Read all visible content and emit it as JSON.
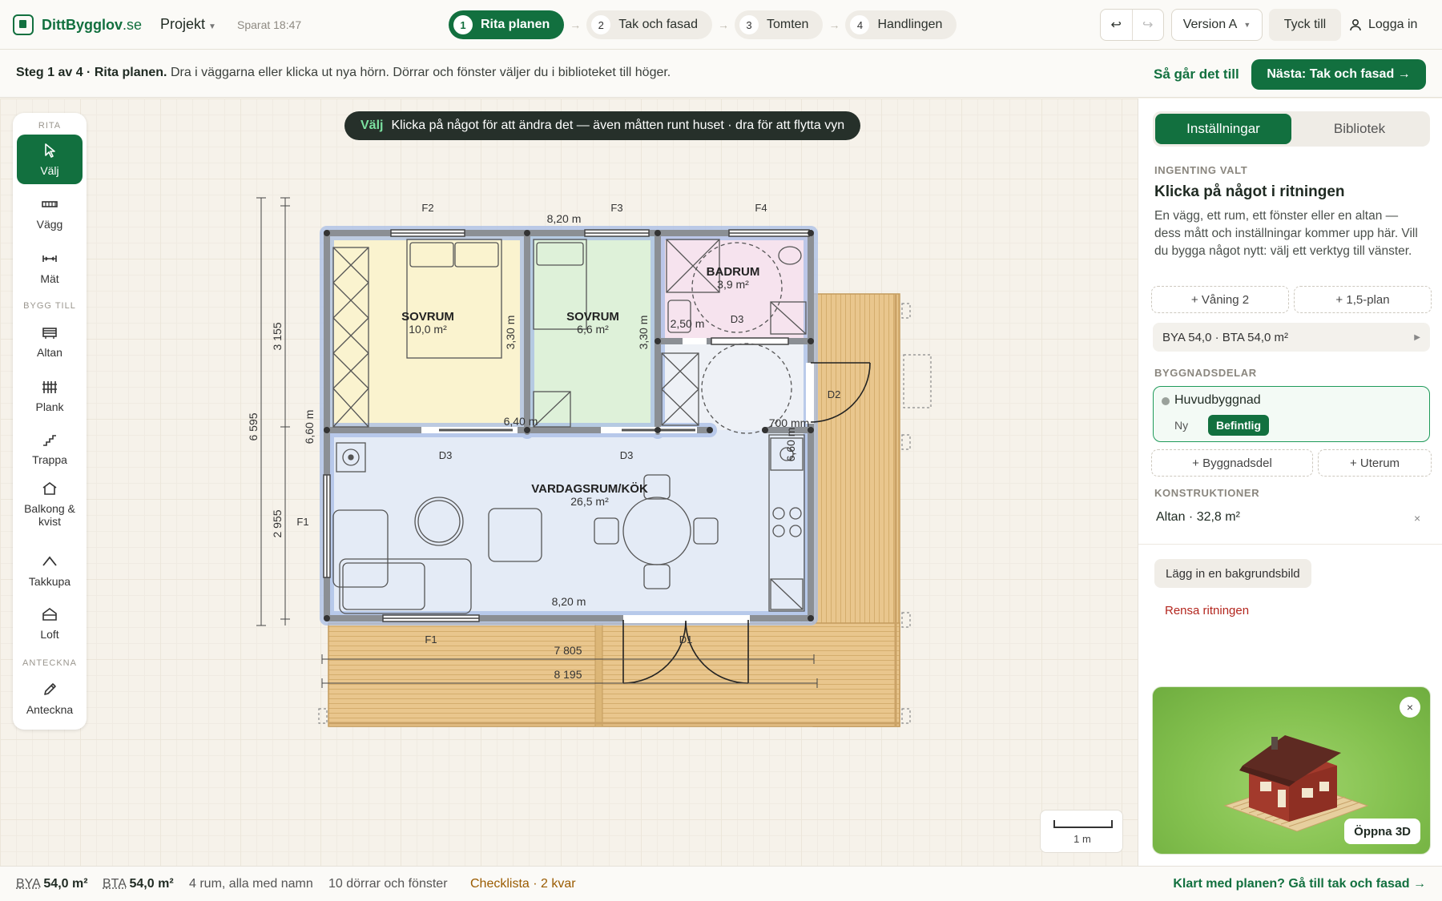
{
  "app": {
    "logo_bold": "DittBygglov",
    "logo_rest": ".se",
    "project_menu": "Projekt",
    "saved": "Sparat 18:47"
  },
  "steps": [
    {
      "num": "1",
      "label": "Rita planen",
      "active": true
    },
    {
      "num": "2",
      "label": "Tak och fasad",
      "active": false
    },
    {
      "num": "3",
      "label": "Tomten",
      "active": false
    },
    {
      "num": "4",
      "label": "Handlingen",
      "active": false
    }
  ],
  "toolbar": {
    "undo_icon": "undo-icon",
    "redo_icon": "redo-icon",
    "version": "Version A",
    "feedback": "Tyck till",
    "login": "Logga in"
  },
  "stepbar": {
    "prefix": "Steg 1 av 4 · Rita planen.",
    "text": " Dra i väggarna eller klicka ut nya hörn. Dörrar och fönster väljer du i biblioteket till höger.",
    "howto": "Så går det till",
    "next": "Nästa: Tak och fasad →"
  },
  "hint": {
    "tag": "Välj",
    "text": "Klicka på något för att ändra det — även måtten runt huset · dra för att flytta vyn"
  },
  "palette": {
    "head_draw": "RITA",
    "head_add": "BYGG TILL",
    "head_note": "ANTECKNA",
    "tools": {
      "select": "Välj",
      "wall": "Vägg",
      "measure": "Mät",
      "deck": "Altan",
      "fence": "Plank",
      "stairs": "Trappa",
      "balcony": "Balkong & kvist",
      "dormer": "Takkupa",
      "loft": "Loft",
      "annotate": "Anteckna"
    }
  },
  "plan": {
    "rooms": [
      {
        "name": "SOVRUM",
        "area": "10,0 m²"
      },
      {
        "name": "SOVRUM",
        "area": "6,6 m²"
      },
      {
        "name": "BADRUM",
        "area": "3,9 m²"
      },
      {
        "name": "VARDAGSRUM/KÖK",
        "area": "26,5 m²"
      }
    ],
    "labels": {
      "f1_left": "F1",
      "f1_bottom": "F1",
      "f2": "F2",
      "f3": "F3",
      "f4": "F4",
      "d1": "D1",
      "d2": "D2",
      "d3_bath": "D3",
      "d3_a": "D3",
      "d3_b": "D3"
    },
    "dims": {
      "top_width": "8,20 m",
      "bottom_width": "8,20 m",
      "bed1_h": "3,30 m",
      "bed2_h": "3,30 m",
      "bath_w": "2,50 m",
      "inner_w": "6,40 m",
      "passage": "700 mm",
      "side_h": "6,60 m",
      "right_h": "6,60 m",
      "left_total": "6 595",
      "left_upper": "3 155",
      "left_lower": "2 955",
      "bottom_inner": "7 805",
      "bottom_outer": "8 195"
    },
    "scale": "1 m"
  },
  "panel": {
    "tab_settings": "Inställningar",
    "tab_library": "Bibliotek",
    "none_selected": "INGENTING VALT",
    "title": "Klicka på något i ritningen",
    "desc": "En vägg, ett rum, ett fönster eller en altan — dess mått och inställningar kommer upp här. Vill du bygga något nytt: välj ett verktyg till vänster.",
    "add_floor": "+ Våning 2",
    "add_half": "+ 1,5-plan",
    "summary": "BYA 54,0 · BTA 54,0 m²",
    "parts_label": "BYGGNADSDELAR",
    "part_name": "Huvudbyggnad",
    "part_new": "Ny",
    "part_existing": "Befintlig",
    "add_part": "+ Byggnadsdel",
    "add_outdoor": "+ Uterum",
    "constr_label": "KONSTRUKTIONER",
    "constr_item": "Altan · 32,8 m²",
    "bg_image": "Lägg in en bakgrundsbild",
    "clear": "Rensa ritningen",
    "open3d": "Öppna 3D"
  },
  "status": {
    "bya_label": "BYA",
    "bya": "54,0 m²",
    "bta_label": "BTA",
    "bta": "54,0 m²",
    "rooms": "4 rum, alla med namn",
    "openings": "10 dörrar och fönster",
    "checklist": "Checklista · 2 kvar",
    "done": "Klart med planen? Gå till tak och fasad →"
  },
  "colors": {
    "brand": "#12703f",
    "bed1": "#faf3cf",
    "bed2": "#def1d9",
    "bath": "#f6e3ee",
    "living": "#e4ebf6",
    "deck": "#e9c68d",
    "selection": "#8fa9dc"
  }
}
